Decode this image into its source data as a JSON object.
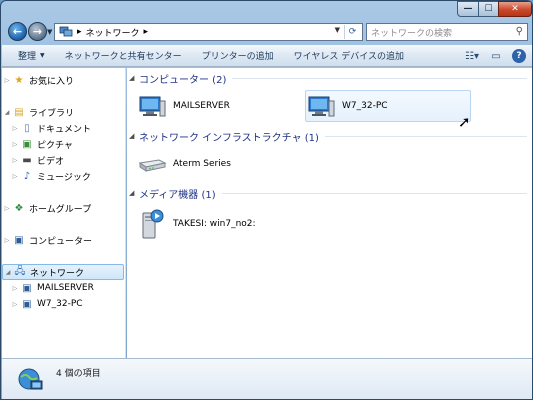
{
  "window": {
    "title_controls": {
      "minimize": "—",
      "maximize": "☐",
      "close": "✕"
    }
  },
  "address": {
    "breadcrumb": "ネットワーク",
    "crumb_arrow": "▸",
    "search_placeholder": "ネットワークの検索"
  },
  "toolbar": {
    "buttons": [
      {
        "label": "整理",
        "dropdown": true
      },
      {
        "label": "ネットワークと共有センター"
      },
      {
        "label": "プリンターの追加"
      },
      {
        "label": "ワイヤレス デバイスの追加"
      }
    ]
  },
  "navpane": {
    "items": [
      {
        "label": "お気に入り",
        "icon": "star-icon"
      },
      {
        "label": "ライブラリ",
        "icon": "library-icon"
      },
      {
        "label": "ドキュメント",
        "icon": "document-icon"
      },
      {
        "label": "ピクチャ",
        "icon": "picture-icon"
      },
      {
        "label": "ビデオ",
        "icon": "video-icon"
      },
      {
        "label": "ミュージック",
        "icon": "music-icon"
      },
      {
        "label": "ホームグループ",
        "icon": "homegroup-icon"
      },
      {
        "label": "コンピューター",
        "icon": "computer-icon"
      },
      {
        "label": "ネットワーク",
        "icon": "network-icon"
      },
      {
        "label": "MAILSERVER",
        "icon": "computer-icon"
      },
      {
        "label": "W7_32-PC",
        "icon": "computer-icon"
      }
    ]
  },
  "content": {
    "groups": [
      {
        "header": "コンピューター (2)",
        "items": [
          {
            "label": "MAILSERVER"
          },
          {
            "label": "W7_32-PC"
          }
        ]
      },
      {
        "header": "ネットワーク インフラストラクチャ (1)",
        "items": [
          {
            "label": "Aterm Series"
          }
        ]
      },
      {
        "header": "メディア機器 (1)",
        "items": [
          {
            "label": "TAKESI: win7_no2:"
          }
        ]
      }
    ]
  },
  "statusbar": {
    "count": "4 個の項目"
  },
  "colors": {
    "accent": "#1e3287",
    "selection": "#cfe6fa",
    "close": "#c9482c"
  }
}
